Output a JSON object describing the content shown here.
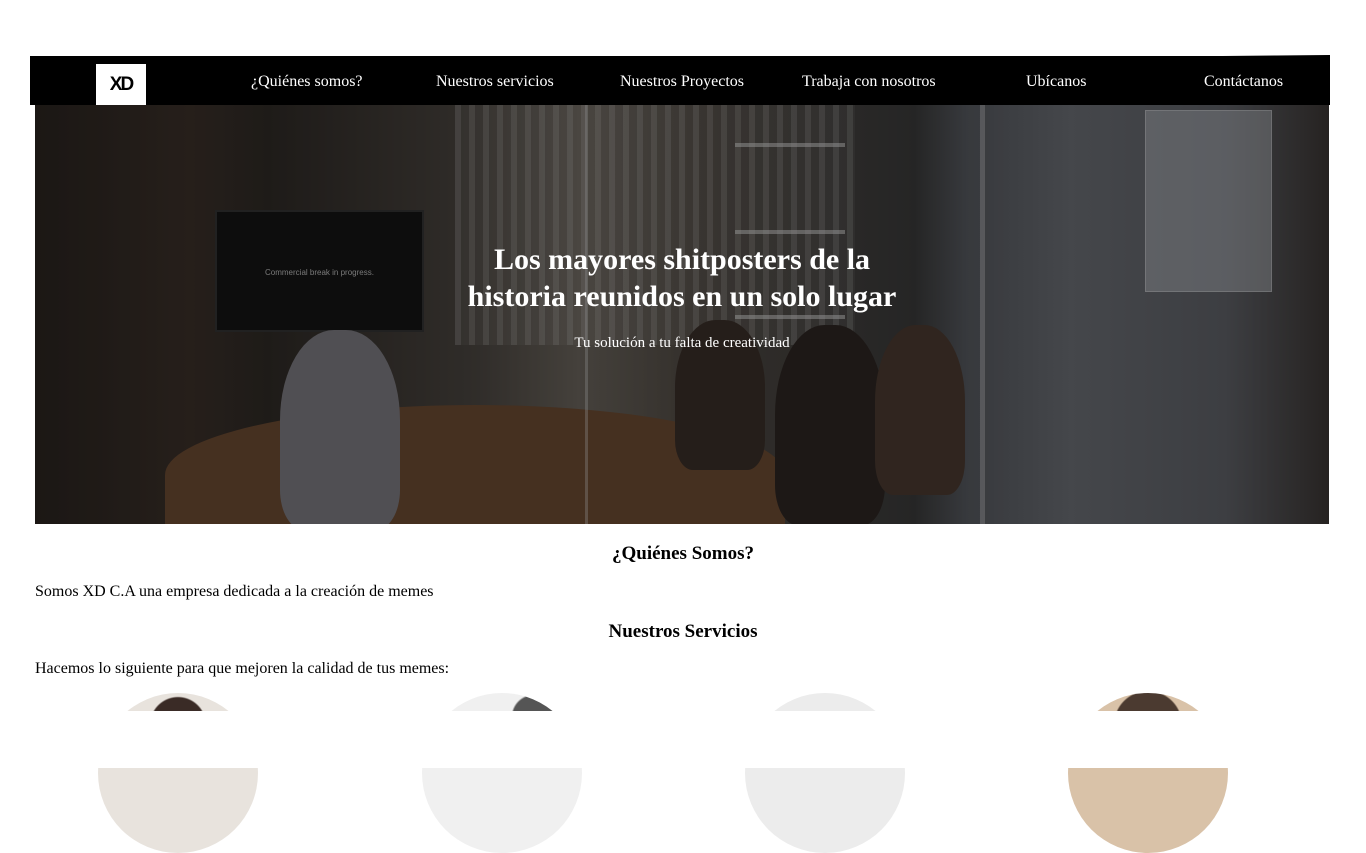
{
  "nav": {
    "logo": "XD",
    "items": [
      {
        "label": "¿Quiénes somos?"
      },
      {
        "label": "Nuestros servicios"
      },
      {
        "label": "Nuestros Proyectos"
      },
      {
        "label": "Trabaja con nosotros"
      },
      {
        "label": "Ubícanos"
      },
      {
        "label": "Contáctanos"
      }
    ]
  },
  "hero": {
    "tv_text": "Commercial break in progress.",
    "title_line1": "Los mayores shitposters de la",
    "title_line2": "historia reunidos en un solo lugar",
    "subtitle": "Tu solución a tu falta de creatividad"
  },
  "about": {
    "heading": "¿Quiénes Somos?",
    "text": "Somos XD C.A una empresa dedicada a la creación de memes"
  },
  "services": {
    "heading": "Nuestros Servicios",
    "text": "Hacemos lo siguiente para que mejoren la calidad de tus memes:"
  },
  "colors": {
    "nav_bg": "#000000",
    "nav_text": "#ffffff",
    "page_bg": "#ffffff"
  }
}
